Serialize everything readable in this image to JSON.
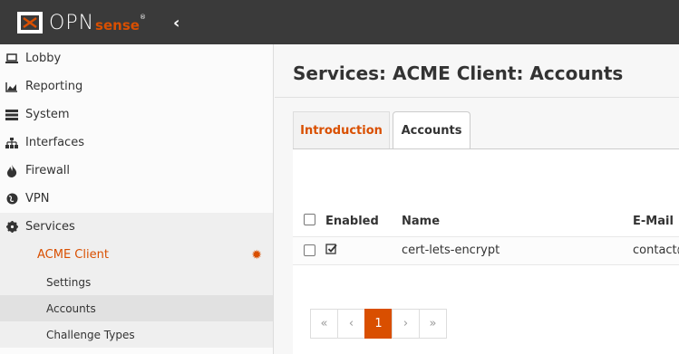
{
  "header": {
    "logo_text": "OPN",
    "logo_sense": "sense",
    "logo_reg": "®",
    "collapse_icon": "‹"
  },
  "sidebar": {
    "items": [
      {
        "label": "Lobby",
        "icon": "laptop-icon"
      },
      {
        "label": "Reporting",
        "icon": "area-chart-icon"
      },
      {
        "label": "System",
        "icon": "server-icon"
      },
      {
        "label": "Interfaces",
        "icon": "sitemap-icon"
      },
      {
        "label": "Firewall",
        "icon": "fire-icon"
      },
      {
        "label": "VPN",
        "icon": "globe-icon"
      },
      {
        "label": "Services",
        "icon": "cog-icon"
      }
    ],
    "acme_client": "ACME Client",
    "subitems": [
      "Settings",
      "Accounts",
      "Challenge Types"
    ]
  },
  "main": {
    "title": "Services: ACME Client: Accounts",
    "tabs": [
      "Introduction",
      "Accounts"
    ],
    "table": {
      "headers": [
        "Enabled",
        "Name",
        "E-Mail"
      ],
      "rows": [
        {
          "enabled": true,
          "name": "cert-lets-encrypt",
          "email": "contact@"
        }
      ]
    },
    "pager": [
      "«",
      "‹",
      "1",
      "›",
      "»"
    ]
  },
  "colors": {
    "accent": "#d94f00",
    "topbar": "#3a3a3a"
  }
}
